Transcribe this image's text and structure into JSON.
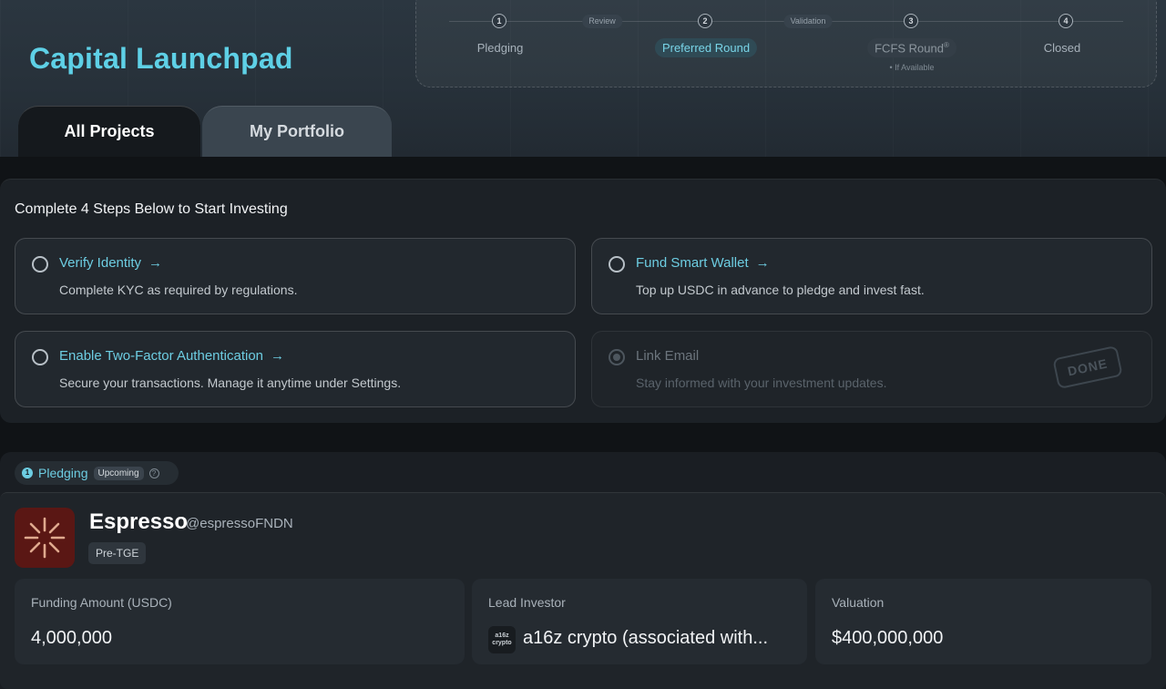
{
  "header": {
    "title": "Capital Launchpad",
    "stepper": {
      "steps": [
        {
          "number": "1",
          "label": "Pledging"
        },
        {
          "number": "2",
          "label": "Preferred Round"
        },
        {
          "number": "3",
          "label": "FCFS Round",
          "superscript": "®",
          "note": "• If Available"
        },
        {
          "number": "4",
          "label": "Closed"
        }
      ],
      "gates": [
        "Review",
        "Validation"
      ],
      "active_step": "Preferred Round"
    }
  },
  "tabs": [
    {
      "label": "All Projects",
      "active": true
    },
    {
      "label": "My Portfolio",
      "active": false
    }
  ],
  "onboarding": {
    "heading": "Complete 4 Steps Below to Start Investing",
    "steps": [
      {
        "title": "Verify Identity",
        "description": "Complete KYC as required by regulations.",
        "done": false
      },
      {
        "title": "Fund Smart Wallet",
        "description": "Top up USDC in advance to pledge and invest fast.",
        "done": false
      },
      {
        "title": "Enable Two-Factor Authentication",
        "description": "Secure your transactions. Manage it anytime under Settings.",
        "done": false
      },
      {
        "title": "Link Email",
        "description": "Stay informed with your investment updates.",
        "done": true
      }
    ],
    "done_stamp": "DONE",
    "arrow_icon": "→"
  },
  "phase": {
    "number": "1",
    "label": "Pledging",
    "badge": "Upcoming",
    "help_icon": "?"
  },
  "project": {
    "name": "Espresso",
    "handle": "@espressoFNDN",
    "tag": "Pre-TGE",
    "logo_color": "#5a1714",
    "stats": {
      "funding_label": "Funding Amount (USDC)",
      "funding_value": "4,000,000",
      "investor_label": "Lead Investor",
      "investor_logo_text": "a16z crypto",
      "investor_value": "a16z crypto (associated with...",
      "valuation_label": "Valuation",
      "valuation_value": "$400,000,000"
    }
  },
  "colors": {
    "accent": "#5ed0e6",
    "background": "#101316",
    "card": "#22282e"
  }
}
